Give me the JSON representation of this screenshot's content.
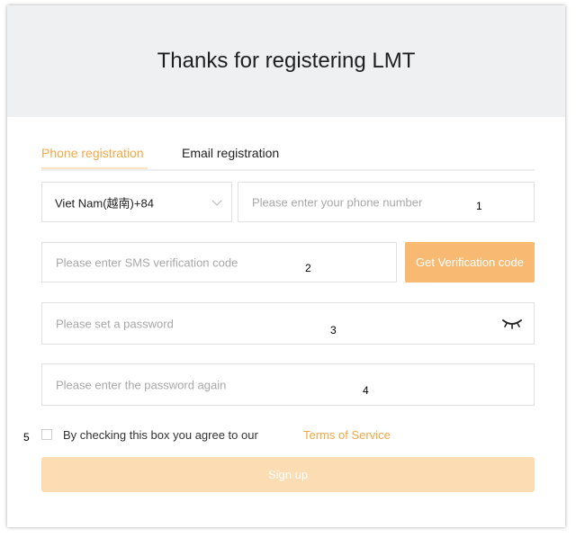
{
  "header": {
    "title": "Thanks for registering LMT"
  },
  "tabs": [
    {
      "label": "Phone registration",
      "active": true
    },
    {
      "label": "Email registration",
      "active": false
    }
  ],
  "form": {
    "country_select_value": "Viet Nam(越南)+84",
    "phone_placeholder": "Please enter your phone number",
    "sms_placeholder": "Please enter SMS verification code",
    "get_code_label": "Get Verification code",
    "password_placeholder": "Please set a password",
    "password_confirm_placeholder": "Please enter the password again",
    "agree_text": "By checking this box you agree to our",
    "terms_label": "Terms of Service",
    "signup_label": "Sign up",
    "agree_checked": false,
    "password_visibility_icon": "eye-closed-icon"
  },
  "markers": [
    "1",
    "2",
    "3",
    "4",
    "5"
  ],
  "colors": {
    "accent": "#f5a847",
    "button": "#f8ba72",
    "button_disabled": "#fcdcb3",
    "header_bg": "#eef0f2"
  }
}
